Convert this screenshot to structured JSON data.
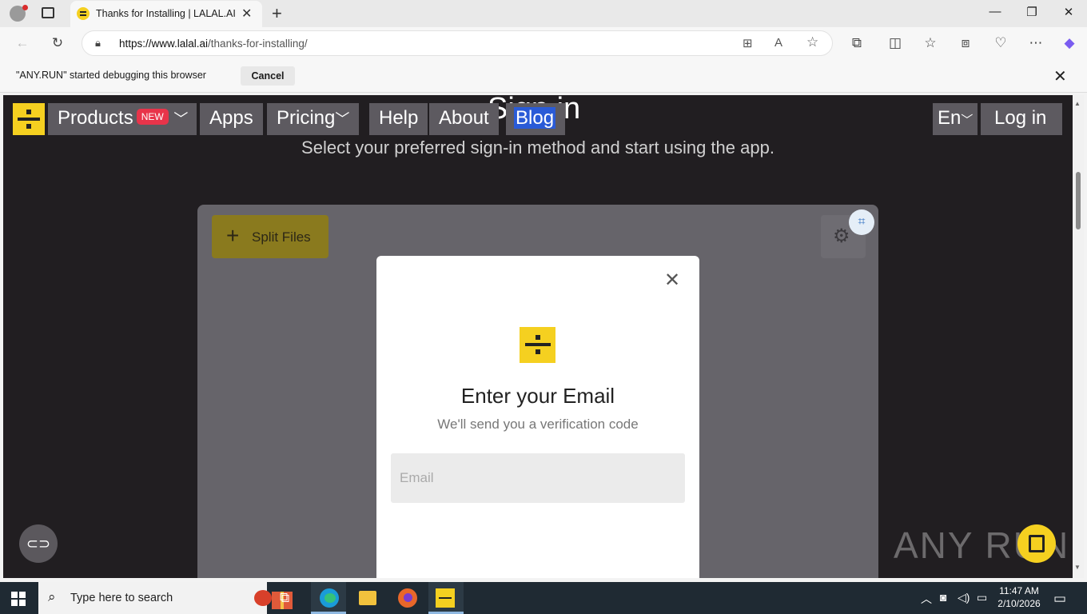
{
  "browser": {
    "tab_title": "Thanks for Installing | LALAL.AI",
    "url_domain": "https://www.lalal.ai",
    "url_path": "/thanks-for-installing/"
  },
  "debug_bar": {
    "message": "\"ANY.RUN\" started debugging this browser",
    "cancel_label": "Cancel"
  },
  "nav": {
    "products": "Products",
    "new_badge": "NEW",
    "apps": "Apps",
    "pricing": "Pricing",
    "help": "Help",
    "about": "About",
    "blog": "Blog",
    "language": "En",
    "login": "Log in"
  },
  "hero": {
    "title": "Sign in",
    "subtitle": "Select your preferred sign-in method and start using the app."
  },
  "panel": {
    "split_files_label": "Split Files"
  },
  "modal": {
    "title": "Enter your Email",
    "subtitle": "We'll send you a verification code",
    "email_placeholder": "Email",
    "email_value": ""
  },
  "watermark": "ANY RUN",
  "taskbar": {
    "search_placeholder": "Type here to search",
    "time": "11:47 AM",
    "date": "2/10/2026"
  },
  "colors": {
    "brand_yellow": "#f5d020",
    "page_bg": "#211e21",
    "nav_box": "#5d5a60",
    "badge_red": "#e8344a"
  }
}
